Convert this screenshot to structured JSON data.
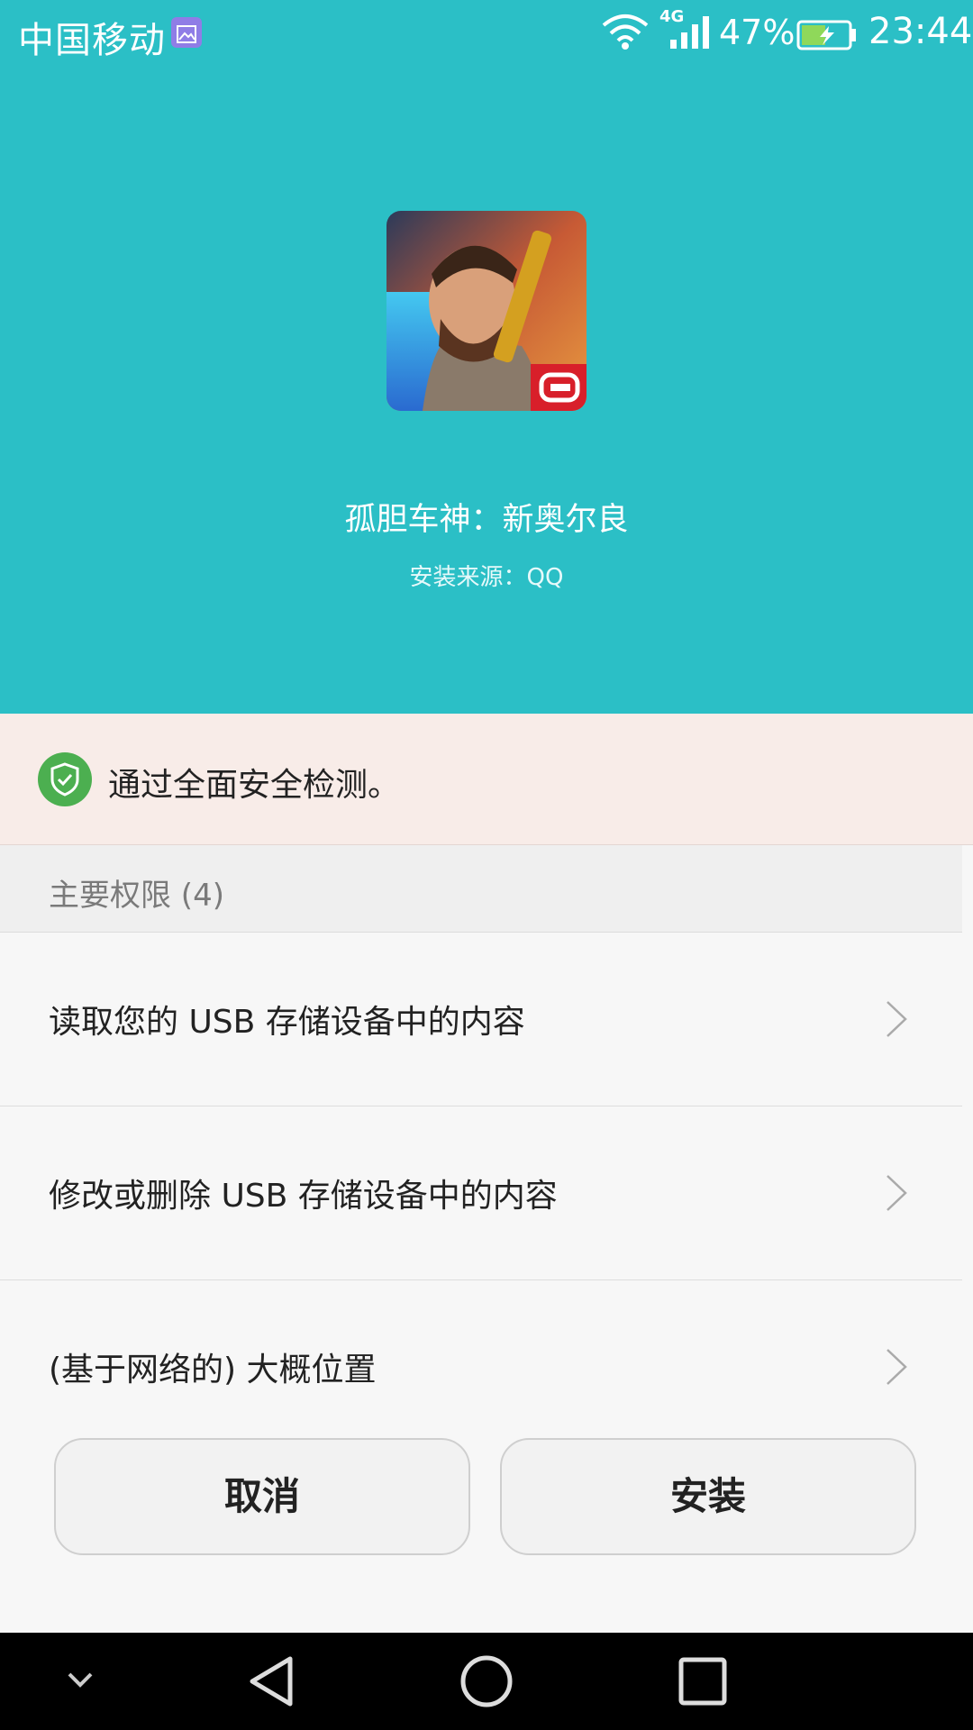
{
  "status_bar": {
    "carrier": "中国移动",
    "network_type": "4G",
    "battery_percent": "47%",
    "time": "23:44",
    "icons": [
      "gallery-notification-icon",
      "wifi-icon",
      "signal-icon",
      "battery-charging-icon"
    ]
  },
  "app": {
    "name": "孤胆车神：新奥尔良",
    "source": "安装来源：QQ",
    "icon": "game-icon"
  },
  "security": {
    "message": "通过全面安全检测。",
    "icon": "shield-check-icon",
    "color": "#4caf50"
  },
  "permissions": {
    "header": "主要权限 (4)",
    "items": [
      {
        "label": "读取您的 USB 存储设备中的内容"
      },
      {
        "label": "修改或删除 USB 存储设备中的内容"
      },
      {
        "label": "(基于网络的) 大概位置"
      }
    ]
  },
  "buttons": {
    "cancel": "取消",
    "install": "安装"
  },
  "nav_bar": {
    "icons": [
      "collapse-icon",
      "back-icon",
      "home-icon",
      "recents-icon"
    ]
  },
  "colors": {
    "header_bg": "#2bbfc6",
    "banner_bg": "#f8ece8"
  }
}
